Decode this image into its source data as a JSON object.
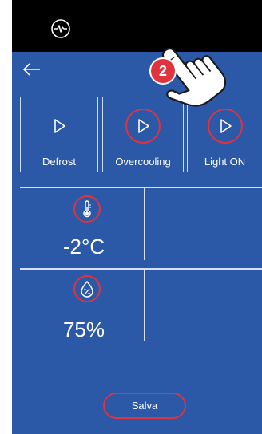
{
  "actions": [
    {
      "label": "Defrost",
      "icon": "play-icon"
    },
    {
      "label": "Overcooling",
      "icon": "play-icon"
    },
    {
      "label": "Light ON",
      "icon": "play-icon"
    }
  ],
  "sensors": {
    "temperature": {
      "value": "-2°C",
      "icon": "thermometer-icon"
    },
    "humidity": {
      "value": "75%",
      "icon": "humidity-icon"
    }
  },
  "save_label": "Salva",
  "tutorial": {
    "step": "2"
  },
  "colors": {
    "background": "#2c58a8",
    "highlight": "#e0333e",
    "status_bar": "#000000"
  }
}
